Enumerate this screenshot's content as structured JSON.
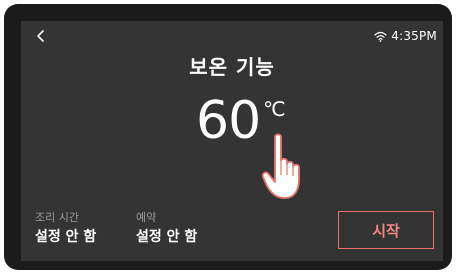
{
  "status_bar": {
    "time": "4:35PM",
    "wifi_icon": "wifi-icon",
    "back_icon": "chevron-left-icon"
  },
  "screen": {
    "title": "보온 기능",
    "temperature": {
      "value": "60",
      "unit": "℃"
    }
  },
  "settings": {
    "cook_time": {
      "label": "조리 시간",
      "value": "설정 안 함"
    },
    "reservation": {
      "label": "예약",
      "value": "설정 안 함"
    }
  },
  "actions": {
    "start_label": "시작"
  },
  "colors": {
    "screen_bg": "#343434",
    "bezel": "#1b1b1b",
    "accent": "#e3756c",
    "label_gray": "#9a9a9a"
  }
}
